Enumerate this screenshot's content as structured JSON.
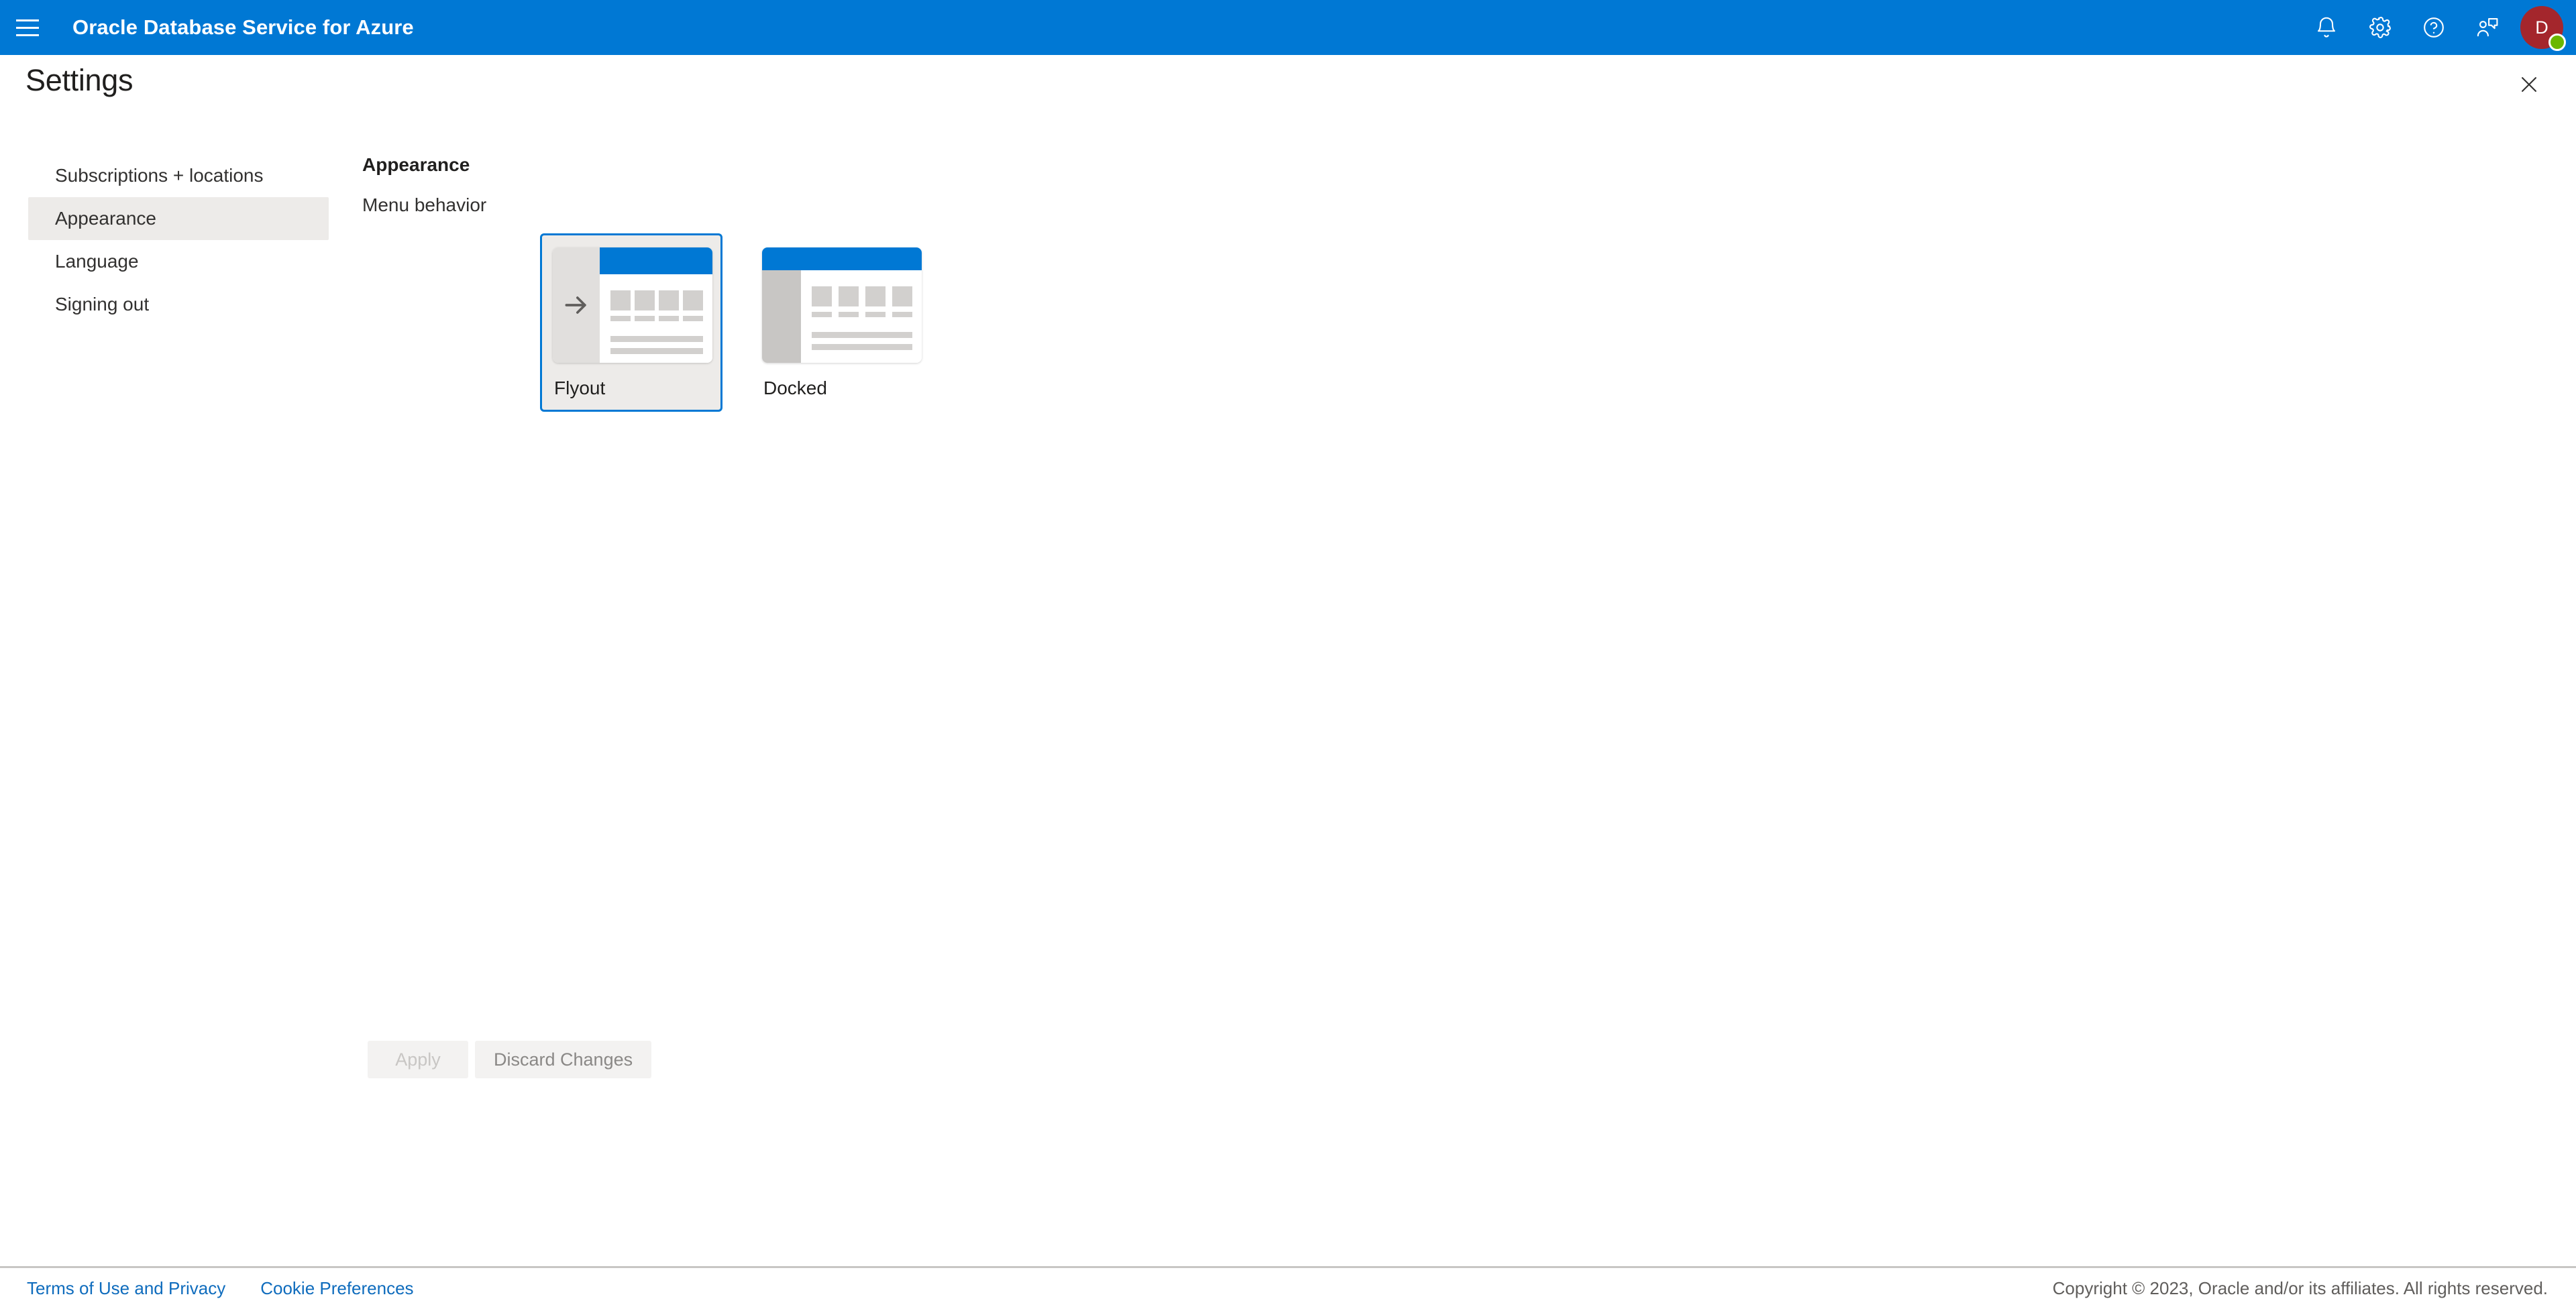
{
  "topbar": {
    "menu_icon": "hamburger-menu-icon",
    "brand": "Oracle Database Service for Azure",
    "icons": [
      {
        "name": "notifications-icon",
        "label": "Notifications"
      },
      {
        "name": "settings-gear-icon",
        "label": "Settings"
      },
      {
        "name": "help-icon",
        "label": "Help"
      },
      {
        "name": "feedback-icon",
        "label": "Feedback"
      }
    ],
    "avatar": {
      "initial": "D",
      "background_color": "#A4262C",
      "presence_color": "#6BB700"
    }
  },
  "page": {
    "title": "Settings",
    "close_icon": "close-icon"
  },
  "sidebar": {
    "items": [
      {
        "label": "Subscriptions + locations",
        "selected": false
      },
      {
        "label": "Appearance",
        "selected": true
      },
      {
        "label": "Language",
        "selected": false
      },
      {
        "label": "Signing out",
        "selected": false
      }
    ]
  },
  "content": {
    "heading": "Appearance",
    "field_label": "Menu behavior",
    "options": [
      {
        "label": "Flyout",
        "selected": true,
        "variant": "flyout"
      },
      {
        "label": "Docked",
        "selected": false,
        "variant": "docked"
      }
    ]
  },
  "actions": {
    "apply_label": "Apply",
    "discard_label": "Discard Changes"
  },
  "footer": {
    "links": [
      {
        "label": "Terms of Use and Privacy"
      },
      {
        "label": "Cookie Preferences"
      }
    ],
    "copyright": "Copyright © 2023, Oracle and/or its affiliates. All rights reserved."
  },
  "colors": {
    "brand_blue": "#0078D4",
    "selected_nav_bg": "#EDEBE9",
    "link_blue": "#0F6CBD"
  }
}
